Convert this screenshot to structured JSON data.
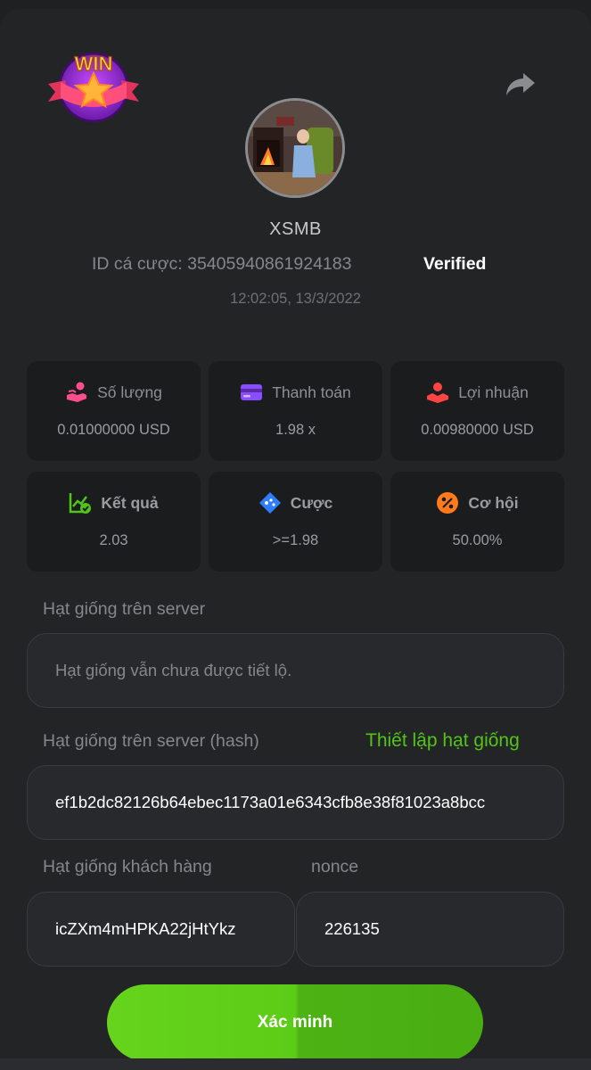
{
  "header": {
    "logo_text": "WIN",
    "game_name": "XSMB",
    "bet_id_label": "ID cá cược: 35405940861924183",
    "verified_label": "Verified",
    "timestamp": "12:02:05, 13/3/2022"
  },
  "stats": [
    {
      "label": "Số lượng",
      "value": "0.01000000 USD",
      "icon": "pink-hand-coin-icon"
    },
    {
      "label": "Thanh toán",
      "value": "1.98 x",
      "icon": "purple-card-icon"
    },
    {
      "label": "Lợi nhuận",
      "value": "0.00980000 USD",
      "icon": "red-profit-hand-icon"
    },
    {
      "label": "Kết quả",
      "value": "2.03",
      "icon": "green-chart-check-icon"
    },
    {
      "label": "Cược",
      "value": ">=1.98",
      "icon": "blue-ticket-icon"
    },
    {
      "label": "Cơ hội",
      "value": "50.00%",
      "icon": "orange-percent-icon"
    }
  ],
  "server_seed": {
    "label": "Hạt giống trên server",
    "placeholder": "Hạt giống vẫn chưa được tiết lộ."
  },
  "server_hash": {
    "label": "Hạt giống trên server (hash)",
    "link": "Thiết lập hạt giống",
    "value": "ef1b2dc82126b64ebec1173a01e6343cfb8e38f81023a8bcc"
  },
  "client_seed": {
    "label": "Hạt giống khách hàng",
    "value": "icZXm4mHPKA22jHtYkz"
  },
  "nonce": {
    "label": "nonce",
    "value": "226135"
  },
  "verify_button": "Xác minh",
  "colors": {
    "accent_green": "#52c41a",
    "card_bg": "#232426",
    "stat_bg": "#1b1c1e"
  }
}
